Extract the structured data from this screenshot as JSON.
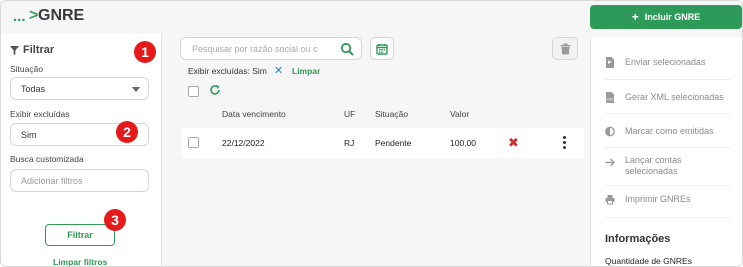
{
  "header": {
    "breadcrumb_dots": "...",
    "breadcrumb_sep": ">",
    "title": "GNRE",
    "add_button": "Incluir GNRE"
  },
  "filters": {
    "title": "Filtrar",
    "situacao_label": "Situação",
    "situacao_value": "Todas",
    "exibir_label": "Exibir excluídas",
    "exibir_value": "Sim",
    "busca_label": "Busca customizada",
    "busca_placeholder": "Adicionar filtros",
    "filter_button": "Filtrar",
    "clear_link": "Limpar filtros"
  },
  "badges": [
    "1",
    "2",
    "3"
  ],
  "toolbar": {
    "search_placeholder": "Pesquisar por razão social ou c",
    "active_filter": "Exibir excluídas: Sim",
    "active_filter_remove": "✕",
    "clear": "Limpar"
  },
  "table": {
    "columns": [
      "Data vencimento",
      "UF",
      "Situação",
      "Valor"
    ],
    "rows": [
      {
        "data": "22/12/2022",
        "uf": "RJ",
        "situacao": "Pendente",
        "valor": "100,00"
      }
    ]
  },
  "actions": [
    {
      "label": "Enviar selecionadas",
      "icon": "file-send-icon"
    },
    {
      "label": "Gerar XML selecionadas",
      "icon": "file-xml-icon"
    },
    {
      "label": "Marcar como emitidas",
      "icon": "half-circle-icon"
    },
    {
      "label": "Lançar contas selecionadas",
      "icon": "arrow-right-icon"
    },
    {
      "label": "Imprimir GNREs",
      "icon": "printer-icon"
    }
  ],
  "info": {
    "title": "Informações",
    "subtitle": "Quantidade de GNREs"
  },
  "colors": {
    "brand_green": "#2e9a5a",
    "badge_red": "#e51b1b",
    "delete_red": "#c9302c"
  }
}
